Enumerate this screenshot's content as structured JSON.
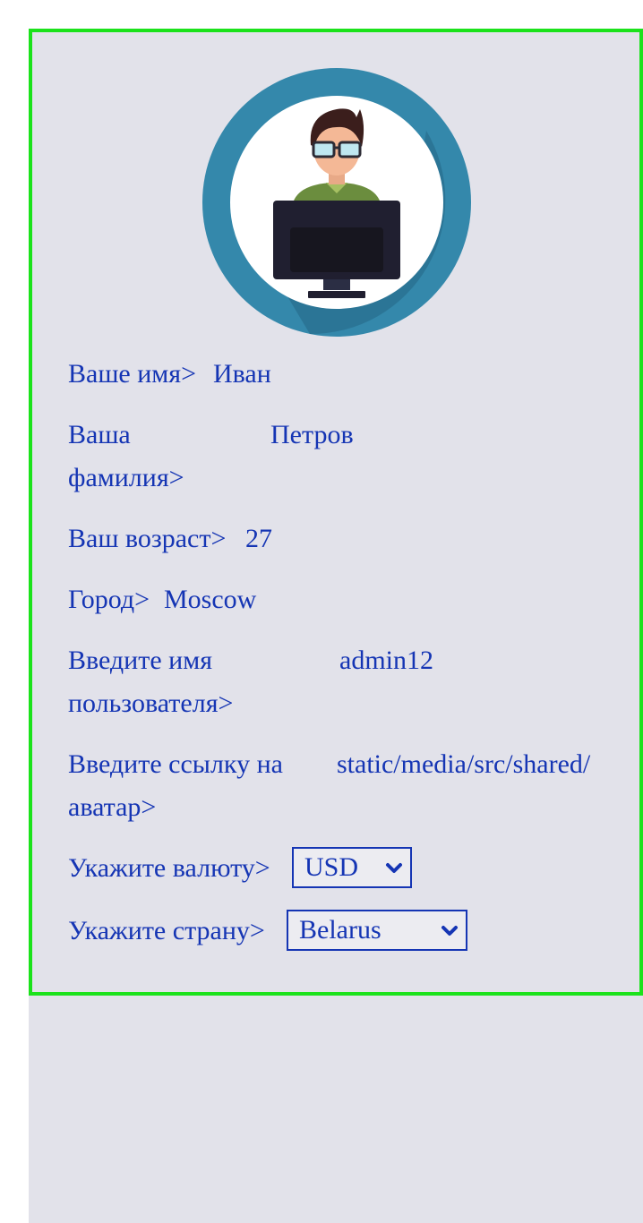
{
  "profile": {
    "name": {
      "label": "Ваше имя>",
      "value": "Иван"
    },
    "surname": {
      "label_line1": "Ваша",
      "label_line2": "фамилия>",
      "value": "Петров"
    },
    "age": {
      "label": "Ваш возраст>",
      "value": "27"
    },
    "city": {
      "label": "Город>",
      "value": "Moscow"
    },
    "username": {
      "label_line1": "Введите имя",
      "label_line2": "пользователя>",
      "value": "admin12"
    },
    "avatar_link": {
      "label_line1": "Введите ссылку на",
      "label_line2": "аватар>",
      "value": "static/media/src/shared/"
    },
    "currency": {
      "label": "Укажите валюту>",
      "selected": "USD"
    },
    "country": {
      "label": "Укажите страну>",
      "selected": "Belarus"
    }
  },
  "icons": {
    "avatar": "user-at-computer-icon",
    "select_arrow": "chevron-down-icon"
  },
  "colors": {
    "text": "#1535b4",
    "card_border": "#1be21b",
    "card_background": "#e2e2ea",
    "avatar_ring": "#3488ab"
  }
}
